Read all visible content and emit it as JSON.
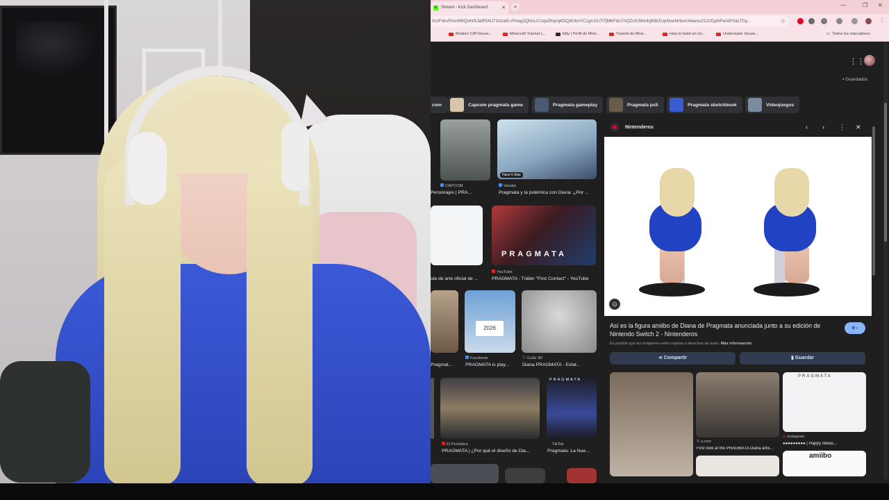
{
  "browser": {
    "tab_title": "Stream - Kick Dashboard",
    "tab_icon": "K",
    "url": "0czFdcvPnxr8WQohrfLfa9fS4tJ71b2alG-Pmeg2QNcLCUqsZKqmjKDQdUhxYC1gA1iUTi7jMKFdu7rtQZcX3Wx4rj80bZUpNswNrfaxU4awsu2122OpNPeAtPVaLTGy...",
    "bookmarks": [
      "Modern Cliff House...",
      "Minecraft Tutorial L...",
      "kitty | Perfil de Mine...",
      "Tutorial de Mine...",
      "How to build an Un...",
      "Underwater House..."
    ],
    "all_bookmarks": "Todos los marcadores",
    "accent": "#f3cfd6"
  },
  "google": {
    "saved": "Guardados",
    "chips": [
      "com",
      "Capcom pragmata game",
      "Pragmata gameplay",
      "Pragmata ps5",
      "Pragmata sketchbook",
      "Videojuegos"
    ],
    "results": [
      {
        "source": "CAPCOM",
        "caption": "Personajes | PRA..."
      },
      {
        "source": "Vandal",
        "caption": "Pragmata y la polémica con Diana: ¿Por ...",
        "badge": "Hace 6 días"
      },
      {
        "source": "",
        "caption": "ula de arte oficial de ..."
      },
      {
        "source": "YouTube",
        "caption": "PRAGMATA - Tráiler \"First Contact\" - YouTube",
        "overlay": "PRAGMATA"
      },
      {
        "source": "",
        "caption": "Pragmat..."
      },
      {
        "source": "Facebook",
        "caption": "PRAGMATA is play...",
        "sign": "2026"
      },
      {
        "source": "Cults 3D",
        "caption": "Diana PRAGMATA - Estat..."
      },
      {
        "source": "El Periódico",
        "caption": "PRAGMATA | ¿Por qué el diseño de Dia..."
      },
      {
        "source": "TikTok",
        "caption": "Pragmata: La Nue...",
        "overlay": "PRAGMATA"
      }
    ]
  },
  "panel": {
    "site": "Nintenderos",
    "title": "Así es la figura amiibo de Diana de Pragmata anunciada junto a su edición de Nintendo Switch 2 - Nintenderos",
    "visit": "Ir",
    "disclaimer": "Es posible que las imágenes estén sujetas a derechos de autor.",
    "more_info": "Más información",
    "share": "Compartir",
    "save": "Guardar",
    "related": [
      {
        "source": "",
        "caption": ""
      },
      {
        "source": "x.com",
        "caption": "First look at the PRAGMATA Diana amii..."
      },
      {
        "source": "Instagram",
        "caption": "●●●●●●●●● | Happy releas...",
        "overlay": "PRAGMATA"
      },
      {
        "source": "",
        "caption": "",
        "overlay": "amiibo"
      }
    ]
  }
}
